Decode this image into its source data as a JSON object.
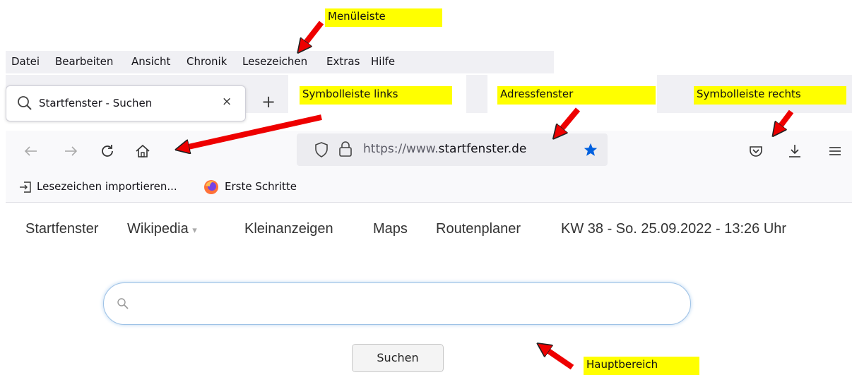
{
  "menubar": {
    "items": [
      "Datei",
      "Bearbeiten",
      "Ansicht",
      "Chronik",
      "Lesezeichen",
      "Extras",
      "Hilfe"
    ]
  },
  "tab": {
    "title": "Startfenster - Suchen",
    "close": "×",
    "new_tab": "+"
  },
  "urlbar": {
    "prefix": "https://www.",
    "domain": "startfenster.de"
  },
  "bookmarks": {
    "import": "Lesezeichen importieren...",
    "first_steps": "Erste Schritte"
  },
  "site_nav": {
    "items": [
      "Startfenster",
      "Wikipedia",
      "Kleinanzeigen",
      "Maps",
      "Routenplaner"
    ],
    "dropdown_marker": "▾",
    "date": "KW 38 - So. 25.09.2022 - 13:26 Uhr"
  },
  "search": {
    "placeholder": "",
    "button": "Suchen"
  },
  "annotations": {
    "menuleiste": "Menüleiste",
    "symbolleiste_links": "Symbolleiste links",
    "adressfenster": "Adressfenster",
    "symbolleiste_rechts": "Symbolleiste rechts",
    "hauptbereich": "Hauptbereich"
  },
  "colors": {
    "annotation_bg": "#ffff00",
    "arrow": "#ee0000",
    "bookmark_star": "#0060df"
  },
  "icons": [
    "search-icon",
    "close-icon",
    "plus-icon",
    "back-icon",
    "forward-icon",
    "reload-icon",
    "home-icon",
    "shield-icon",
    "lock-icon",
    "star-icon",
    "pocket-icon",
    "download-icon",
    "menu-icon",
    "import-icon",
    "firefox-icon"
  ]
}
